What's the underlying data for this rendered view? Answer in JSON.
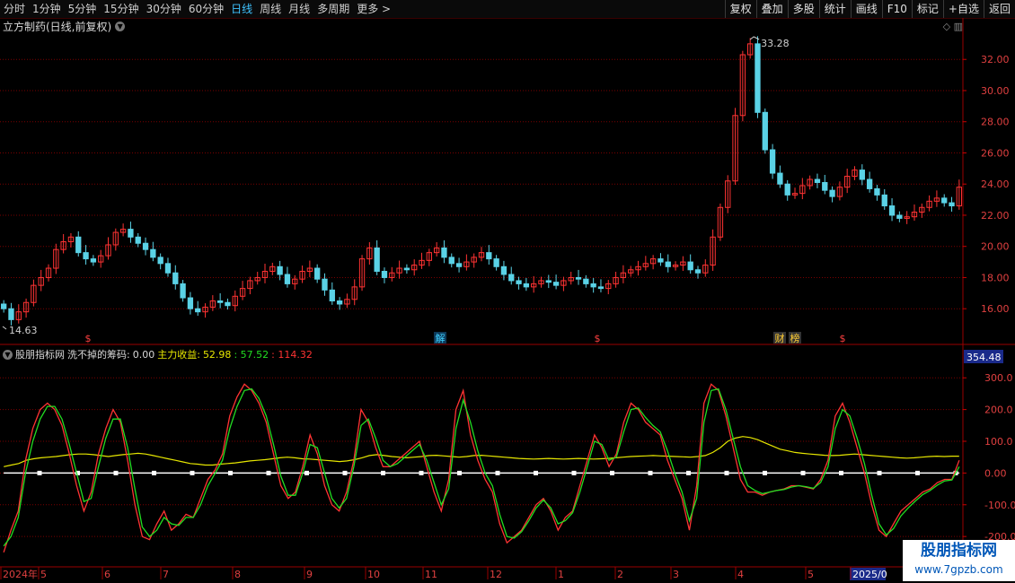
{
  "toolbar": {
    "periods": [
      "分时",
      "1分钟",
      "5分钟",
      "15分钟",
      "30分钟",
      "60分钟",
      "日线",
      "周线",
      "月线",
      "多周期",
      "更多 >"
    ],
    "active_period": "日线",
    "buttons": [
      "复权",
      "叠加",
      "多股",
      "统计",
      "画线",
      "F10",
      "标记",
      "+自选",
      "返回"
    ]
  },
  "main_chart": {
    "title": "立方制药(日线,前复权)",
    "high_label": "33.28",
    "low_label": "14.63",
    "y_ticks": [
      "32.00",
      "30.00",
      "28.00",
      "26.00",
      "24.00",
      "22.00",
      "20.00",
      "18.00",
      "16.00"
    ],
    "event_markers": [
      "$",
      "解",
      "$",
      "财",
      "榜",
      "$"
    ]
  },
  "indicator": {
    "source": "股朋指标网",
    "name": "洗不掉的筹码:",
    "value1": "0.00",
    "label2": "主力收益:",
    "value2": "52.98",
    "value3": ": 57.52",
    "value4": ": 114.32",
    "top_value": "354.48",
    "y_ticks": [
      "300.0",
      "200.0",
      "100.0",
      "0.00",
      "-100.0",
      "-200.0"
    ]
  },
  "x_axis": {
    "labels": [
      "2024年",
      "5",
      "6",
      "7",
      "8",
      "9",
      "10",
      "11",
      "12",
      "1",
      "2",
      "3",
      "4",
      "5",
      "2025/0"
    ]
  },
  "watermark": {
    "title": "股朋指标网",
    "url": "www.7gpzb.com"
  },
  "colors": {
    "up": "#ff3333",
    "down": "#5ad2e6",
    "grid": "#7a0000",
    "green_line": "#22dd22",
    "yellow_line": "#e6e600"
  },
  "chart_data": {
    "type": "candlestick",
    "ylim": [
      14.63,
      33.28
    ],
    "closes": [
      16.0,
      15.3,
      15.8,
      16.4,
      17.5,
      18.0,
      18.6,
      19.8,
      20.3,
      20.6,
      19.6,
      19.2,
      19.0,
      19.4,
      20.1,
      20.9,
      21.1,
      20.6,
      20.2,
      19.8,
      19.3,
      18.9,
      18.3,
      17.6,
      16.7,
      16.0,
      15.8,
      16.1,
      16.5,
      16.4,
      16.2,
      16.8,
      17.3,
      17.8,
      18.0,
      18.4,
      18.7,
      18.2,
      17.6,
      17.9,
      18.4,
      18.6,
      17.9,
      17.2,
      16.5,
      16.3,
      16.6,
      17.4,
      19.2,
      19.9,
      18.4,
      18.0,
      18.3,
      18.6,
      18.5,
      18.8,
      19.1,
      19.6,
      19.9,
      19.3,
      18.9,
      18.7,
      19.0,
      19.3,
      19.6,
      19.2,
      18.7,
      18.2,
      17.8,
      17.6,
      17.4,
      17.6,
      17.8,
      17.7,
      17.5,
      17.8,
      18.0,
      17.9,
      17.6,
      17.4,
      17.3,
      17.6,
      18.0,
      18.3,
      18.5,
      18.7,
      18.9,
      19.2,
      19.0,
      18.7,
      18.8,
      19.0,
      18.5,
      18.3,
      18.8,
      20.6,
      22.5,
      24.2,
      28.4,
      32.3,
      33.0,
      28.6,
      26.2,
      24.7,
      24.0,
      23.3,
      23.4,
      23.9,
      24.3,
      24.1,
      23.6,
      23.2,
      23.8,
      24.5,
      24.9,
      24.3,
      23.7,
      23.3,
      22.6,
      22.0,
      21.8,
      21.9,
      22.2,
      22.5,
      22.9,
      23.1,
      22.8,
      22.6,
      23.8
    ],
    "ind_series": [
      {
        "name": "洗不掉的筹码",
        "values": [
          0,
          0,
          0,
          0,
          0,
          0,
          0,
          0,
          0,
          0,
          0,
          0,
          0,
          0,
          0,
          0,
          0,
          0,
          0,
          0,
          0,
          0,
          0,
          0,
          0,
          0,
          0,
          0,
          0,
          0,
          0,
          0,
          0,
          0,
          0,
          0,
          0,
          0,
          0,
          0,
          0,
          0,
          0,
          0,
          0,
          0,
          0,
          0,
          0,
          0,
          0,
          0,
          0,
          0,
          0,
          0,
          0,
          0,
          0,
          0,
          0,
          0,
          0,
          0,
          0,
          0,
          0,
          0,
          0,
          0,
          0,
          0,
          0,
          0,
          0,
          0,
          0,
          0,
          0,
          0,
          0,
          0,
          0,
          0,
          0,
          0,
          0,
          0,
          0,
          0,
          0,
          0,
          0,
          0,
          0,
          0,
          0,
          0,
          0,
          0,
          0,
          0,
          0,
          0,
          0,
          0,
          0,
          0,
          0,
          0,
          0,
          0,
          0,
          0,
          0,
          0,
          0,
          0,
          0,
          0,
          0,
          0,
          0,
          0,
          0,
          0,
          0,
          0,
          0,
          0
        ]
      },
      {
        "name": "主力收益",
        "values": [
          20,
          25,
          30,
          40,
          45,
          48,
          50,
          52,
          55,
          58,
          60,
          60,
          58,
          55,
          52,
          55,
          58,
          60,
          62,
          60,
          55,
          50,
          45,
          40,
          35,
          30,
          28,
          25,
          25,
          28,
          30,
          32,
          35,
          38,
          40,
          42,
          45,
          48,
          50,
          48,
          45,
          44,
          42,
          40,
          38,
          36,
          38,
          42,
          48,
          55,
          58,
          55,
          52,
          50,
          48,
          50,
          52,
          55,
          56,
          54,
          52,
          50,
          52,
          55,
          56,
          54,
          52,
          50,
          48,
          46,
          45,
          44,
          45,
          46,
          45,
          44,
          45,
          46,
          45,
          44,
          45,
          46,
          48,
          50,
          52,
          53,
          54,
          55,
          54,
          53,
          52,
          51,
          50,
          52,
          55,
          65,
          80,
          100,
          110,
          115,
          112,
          105,
          95,
          85,
          75,
          70,
          65,
          62,
          60,
          58,
          56,
          55,
          56,
          58,
          60,
          58,
          56,
          54,
          52,
          50,
          48,
          47,
          48,
          50,
          52,
          53,
          52,
          53,
          53
        ]
      },
      {
        "name": "",
        "values": [
          -250,
          -180,
          -120,
          40,
          140,
          200,
          220,
          200,
          150,
          60,
          -40,
          -120,
          -60,
          60,
          140,
          200,
          160,
          40,
          -100,
          -200,
          -210,
          -160,
          -120,
          -180,
          -160,
          -130,
          -140,
          -80,
          -20,
          10,
          60,
          180,
          240,
          280,
          260,
          220,
          160,
          60,
          -40,
          -80,
          -60,
          20,
          120,
          60,
          -40,
          -100,
          -120,
          -60,
          40,
          200,
          160,
          80,
          20,
          20,
          40,
          60,
          80,
          100,
          20,
          -60,
          -120,
          -20,
          200,
          260,
          120,
          40,
          -20,
          -60,
          -160,
          -220,
          -200,
          -180,
          -140,
          -100,
          -80,
          -120,
          -180,
          -140,
          -120,
          -40,
          40,
          120,
          80,
          20,
          60,
          160,
          220,
          200,
          160,
          140,
          120,
          40,
          -20,
          -80,
          -180,
          -40,
          220,
          280,
          260,
          180,
          80,
          -20,
          -60,
          -60,
          -70,
          -60,
          -55,
          -50,
          -40,
          -40,
          -45,
          -50,
          -20,
          40,
          180,
          220,
          160,
          80,
          0,
          -100,
          -180,
          -200,
          -160,
          -120,
          -100,
          -80,
          -60,
          -50,
          -30,
          -20,
          -20,
          40
        ]
      },
      {
        "name": "",
        "values": [
          -230,
          -200,
          -140,
          0,
          100,
          170,
          210,
          210,
          170,
          90,
          0,
          -90,
          -80,
          20,
          110,
          170,
          170,
          80,
          -50,
          -170,
          -200,
          -180,
          -140,
          -160,
          -165,
          -140,
          -140,
          -100,
          -40,
          0,
          40,
          140,
          210,
          260,
          265,
          235,
          180,
          90,
          -10,
          -70,
          -70,
          0,
          90,
          80,
          0,
          -80,
          -110,
          -80,
          20,
          150,
          170,
          110,
          40,
          20,
          30,
          50,
          70,
          90,
          40,
          -30,
          -100,
          -50,
          140,
          230,
          160,
          70,
          0,
          -40,
          -130,
          -200,
          -205,
          -185,
          -150,
          -110,
          -85,
          -110,
          -160,
          -150,
          -125,
          -60,
          20,
          100,
          90,
          40,
          50,
          130,
          200,
          205,
          175,
          150,
          130,
          70,
          0,
          -60,
          -150,
          -80,
          160,
          260,
          265,
          200,
          110,
          20,
          -40,
          -55,
          -65,
          -60,
          -55,
          -52,
          -44,
          -40,
          -43,
          -48,
          -30,
          20,
          140,
          200,
          180,
          110,
          30,
          -70,
          -160,
          -195,
          -175,
          -135,
          -110,
          -88,
          -68,
          -55,
          -38,
          -25,
          -22,
          20
        ]
      }
    ]
  }
}
